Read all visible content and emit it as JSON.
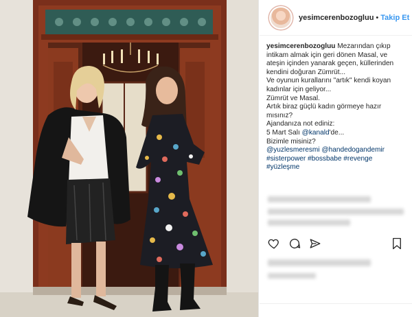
{
  "post": {
    "username": "yesimcerenbozogluu",
    "follow_label": "Takip Et",
    "separator": "•",
    "caption_lines": [
      "Mezarından çıkıp",
      "intikam almak için geri dönen Masal, ve",
      "ateşin içinden yanarak geçen, küllerinden",
      "kendini doğuran Zümrüt...",
      "Ve oyunun kurallarını \"artık\" kendi koyan",
      "kadınlar için geliyor...",
      "Zümrüt ve Masal.",
      "Artık biraz güçlü kadın görmeye hazır",
      "mısınız?",
      "Ajandanıza not ediniz:",
      "5 Mart Salı",
      "'de...",
      "Bizimle misiniz?"
    ],
    "mention_kanald": "@kanald",
    "mention_line": [
      "@yuzlesmeresmi",
      "@handedogandemir"
    ],
    "hashtag_line": [
      "#sisterpower",
      "#bossbabe",
      "#revenge"
    ],
    "hashtag_last": "#yüzleşme"
  },
  "icons": {
    "like": "heart-icon",
    "comment": "comment-icon",
    "share": "share-icon",
    "save": "bookmark-icon"
  },
  "colors": {
    "link": "#003569",
    "follow": "#3897f0",
    "text": "#262626"
  }
}
